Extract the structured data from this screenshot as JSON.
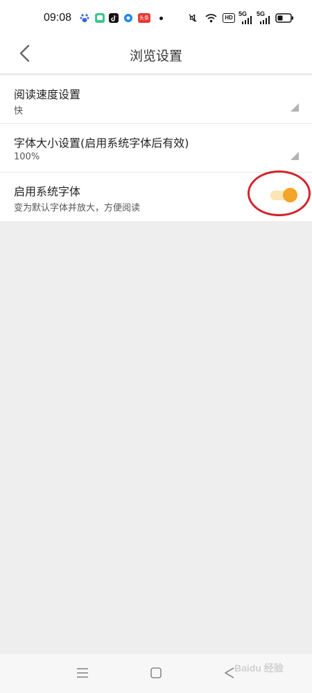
{
  "status_bar": {
    "time": "09:08",
    "network_badges": [
      "HD",
      "5G",
      "5G"
    ],
    "news_app_label": "头条",
    "icons": [
      "baidu-icon",
      "wechat-icon",
      "tiktok-icon",
      "maps-icon",
      "news-app-icon",
      "dot",
      "mute-icon",
      "wifi-icon",
      "hd-badge",
      "signal-5g-icon",
      "signal-5g-icon",
      "battery-icon"
    ]
  },
  "nav": {
    "title": "浏览设置",
    "back_icon": "chevron-left-icon"
  },
  "settings": {
    "rows": [
      {
        "title": "阅读速度设置",
        "value": "快"
      },
      {
        "title": "字体大小设置(启用系统字体后有效)",
        "value": "100%"
      },
      {
        "title": "启用系统字体",
        "subtitle": "变为默认字体并放大，方便阅读",
        "toggle_on": true
      }
    ]
  },
  "bottom_nav": {
    "icons": [
      "menu-icon",
      "home-icon",
      "back-icon"
    ]
  },
  "watermark": "Baidu 经验",
  "colors": {
    "accent": "#f4a426",
    "toggle_track": "#fbe5b4",
    "annotation_ring": "#d3232b",
    "background": "#eeeeee"
  }
}
